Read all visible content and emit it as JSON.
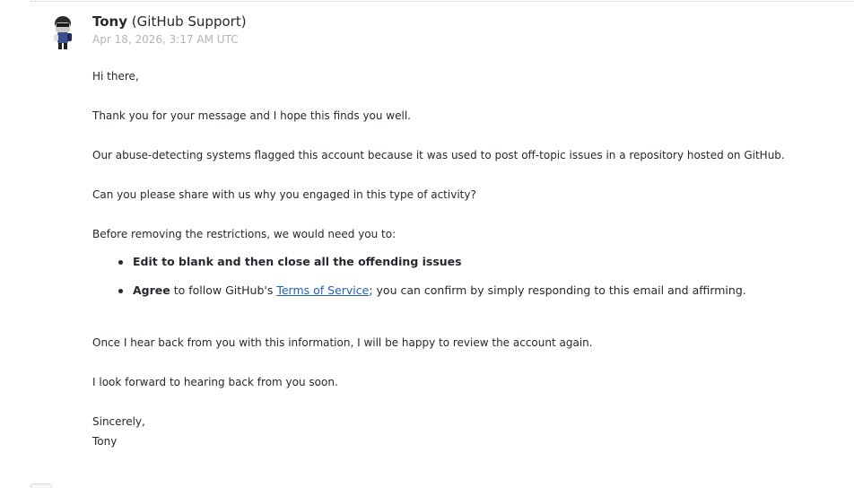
{
  "message": {
    "author_name": "Tony",
    "author_org": "(GitHub Support)",
    "timestamp": "Apr 18, 2026, 3:17 AM UTC",
    "avatar_icon": "support-agent-avatar",
    "greeting": "Hi there,",
    "p1": "Thank you for your message and I hope this finds you well.",
    "p2": "Our abuse-detecting systems flagged this account because it was used to post off-topic issues in a repository hosted on GitHub.",
    "p3": "Can you please share with us why you engaged in this type of activity?",
    "p4": "Before removing the restrictions, we would need you to:",
    "list": {
      "item1": "Edit to blank and then close all the offending issues",
      "item2_bold": "Agree",
      "item2_pre": " to follow GitHub's ",
      "item2_link": "Terms of Service",
      "item2_post": "; you can confirm by simply responding to this email and affirming."
    },
    "p5": "Once I hear back from you with this information, I will be happy to review the account again.",
    "p6": "I look forward to hearing back from you soon.",
    "signoff": "Sincerely,",
    "signature": "Tony"
  },
  "colors": {
    "text": "#24292f",
    "timestamp": "#b0b4b9",
    "link": "#1f5fbf"
  }
}
